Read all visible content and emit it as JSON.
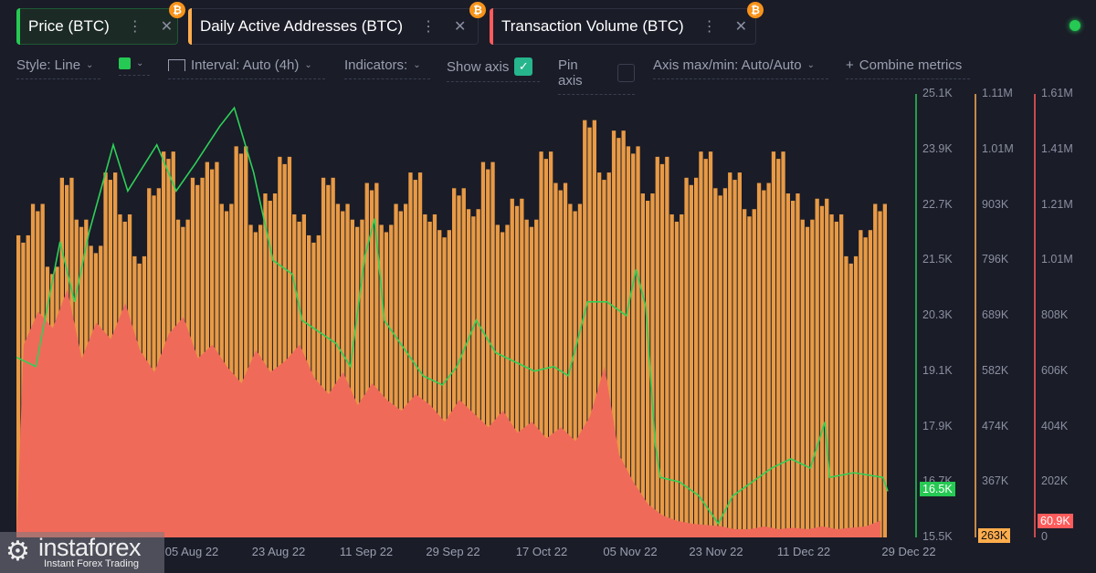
{
  "tabs": [
    {
      "label": "Price (BTC)",
      "color": "#26c953"
    },
    {
      "label": "Daily Active Addresses (BTC)",
      "color": "#ffad4d"
    },
    {
      "label": "Transaction Volume (BTC)",
      "color": "#ff5b5b"
    }
  ],
  "toolbar": {
    "style": "Style: Line",
    "interval": "Interval: Auto (4h)",
    "indicators": "Indicators:",
    "show_axis": "Show axis",
    "show_axis_checked": true,
    "pin_axis": "Pin axis",
    "pin_axis_checked": false,
    "axis_maxmin": "Axis max/min: Auto/Auto",
    "combine": "Combine metrics",
    "color_swatch": "#26c953"
  },
  "status_color": "#26c953",
  "watermark": {
    "brand": "instaforex",
    "tagline": "Instant Forex Trading"
  },
  "chart_data": {
    "type": "line+bar",
    "x_ticks": [
      "05 Aug 22",
      "23 Aug 22",
      "11 Sep 22",
      "29 Sep 22",
      "17 Oct 22",
      "05 Nov 22",
      "23 Nov 22",
      "11 Dec 22",
      "29 Dec 22"
    ],
    "price_axis": {
      "ticks": [
        "25.1K",
        "23.9K",
        "22.7K",
        "21.5K",
        "20.3K",
        "19.1K",
        "17.9K",
        "16.7K",
        "15.5K"
      ],
      "range": [
        15500,
        25100
      ],
      "current": "16.5K",
      "color": "#26c953"
    },
    "addresses_axis": {
      "ticks": [
        "1.11M",
        "1.01M",
        "903K",
        "796K",
        "689K",
        "582K",
        "474K",
        "367K"
      ],
      "range": [
        263000,
        1110000
      ],
      "current": "263K",
      "color": "#ffad4d"
    },
    "volume_axis": {
      "ticks": [
        "1.61M",
        "1.41M",
        "1.21M",
        "1.01M",
        "808K",
        "606K",
        "404K",
        "202K",
        "0"
      ],
      "range": [
        0,
        1610000
      ],
      "current": "60.9K",
      "color": "#ff5b5b"
    },
    "series": [
      {
        "name": "Price (BTC)",
        "type": "line",
        "points": [
          [
            "2022-06-30",
            19400
          ],
          [
            "2022-07-04",
            19200
          ],
          [
            "2022-07-09",
            21900
          ],
          [
            "2022-07-12",
            20600
          ],
          [
            "2022-07-15",
            22100
          ],
          [
            "2022-07-20",
            24000
          ],
          [
            "2022-07-23",
            23000
          ],
          [
            "2022-07-29",
            24000
          ],
          [
            "2022-08-02",
            23000
          ],
          [
            "2022-08-06",
            23600
          ],
          [
            "2022-08-11",
            24400
          ],
          [
            "2022-08-14",
            24800
          ],
          [
            "2022-08-18",
            23400
          ],
          [
            "2022-08-22",
            21500
          ],
          [
            "2022-08-26",
            21200
          ],
          [
            "2022-08-28",
            20200
          ],
          [
            "2022-09-04",
            19700
          ],
          [
            "2022-09-07",
            19200
          ],
          [
            "2022-09-10",
            21600
          ],
          [
            "2022-09-12",
            22400
          ],
          [
            "2022-09-14",
            20200
          ],
          [
            "2022-09-18",
            19600
          ],
          [
            "2022-09-22",
            19000
          ],
          [
            "2022-09-26",
            18800
          ],
          [
            "2022-09-29",
            19200
          ],
          [
            "2022-10-03",
            20200
          ],
          [
            "2022-10-07",
            19500
          ],
          [
            "2022-10-11",
            19300
          ],
          [
            "2022-10-15",
            19100
          ],
          [
            "2022-10-19",
            19200
          ],
          [
            "2022-10-22",
            19000
          ],
          [
            "2022-10-26",
            20600
          ],
          [
            "2022-10-30",
            20600
          ],
          [
            "2022-11-03",
            20300
          ],
          [
            "2022-11-05",
            21300
          ],
          [
            "2022-11-07",
            20500
          ],
          [
            "2022-11-09",
            17500
          ],
          [
            "2022-11-10",
            16800
          ],
          [
            "2022-11-14",
            16700
          ],
          [
            "2022-11-18",
            16400
          ],
          [
            "2022-11-22",
            15800
          ],
          [
            "2022-11-25",
            16400
          ],
          [
            "2022-11-29",
            16700
          ],
          [
            "2022-12-03",
            17000
          ],
          [
            "2022-12-07",
            17200
          ],
          [
            "2022-12-11",
            17000
          ],
          [
            "2022-12-14",
            18000
          ],
          [
            "2022-12-15",
            16800
          ],
          [
            "2022-12-20",
            16900
          ],
          [
            "2022-12-26",
            16800
          ],
          [
            "2022-12-27",
            16500
          ]
        ]
      },
      {
        "name": "Daily Active Addresses (BTC)",
        "type": "bar",
        "start": "2022-06-30",
        "step_days": 3,
        "values": [
          840000,
          900000,
          780000,
          950000,
          870000,
          820000,
          960000,
          880000,
          800000,
          930000,
          1000000,
          870000,
          950000,
          980000,
          900000,
          1010000,
          860000,
          920000,
          990000,
          880000,
          840000,
          950000,
          900000,
          870000,
          940000,
          860000,
          900000,
          960000,
          880000,
          850000,
          930000,
          890000,
          980000,
          860000,
          910000,
          870000,
          1000000,
          940000,
          900000,
          1060000,
          960000,
          1040000,
          1010000,
          920000,
          990000,
          880000,
          950000,
          1000000,
          930000,
          960000,
          890000,
          940000,
          1000000,
          920000,
          870000,
          910000,
          880000,
          800000,
          850000,
          900000
        ]
      },
      {
        "name": "Transaction Volume (BTC)",
        "type": "area",
        "start": "2022-06-30",
        "step_days": 3,
        "values": [
          700000,
          820000,
          760000,
          900000,
          650000,
          780000,
          720000,
          850000,
          680000,
          600000,
          740000,
          800000,
          650000,
          700000,
          620000,
          560000,
          680000,
          600000,
          640000,
          700000,
          580000,
          520000,
          600000,
          480000,
          560000,
          500000,
          460000,
          520000,
          480000,
          420000,
          500000,
          450000,
          400000,
          460000,
          380000,
          420000,
          360000,
          400000,
          350000,
          440000,
          620000,
          300000,
          200000,
          120000,
          80000,
          60000,
          50000,
          45000,
          40000,
          30000,
          30000,
          40000,
          30000,
          35000,
          30000,
          40000,
          30000,
          35000,
          40000,
          60900
        ]
      }
    ]
  }
}
